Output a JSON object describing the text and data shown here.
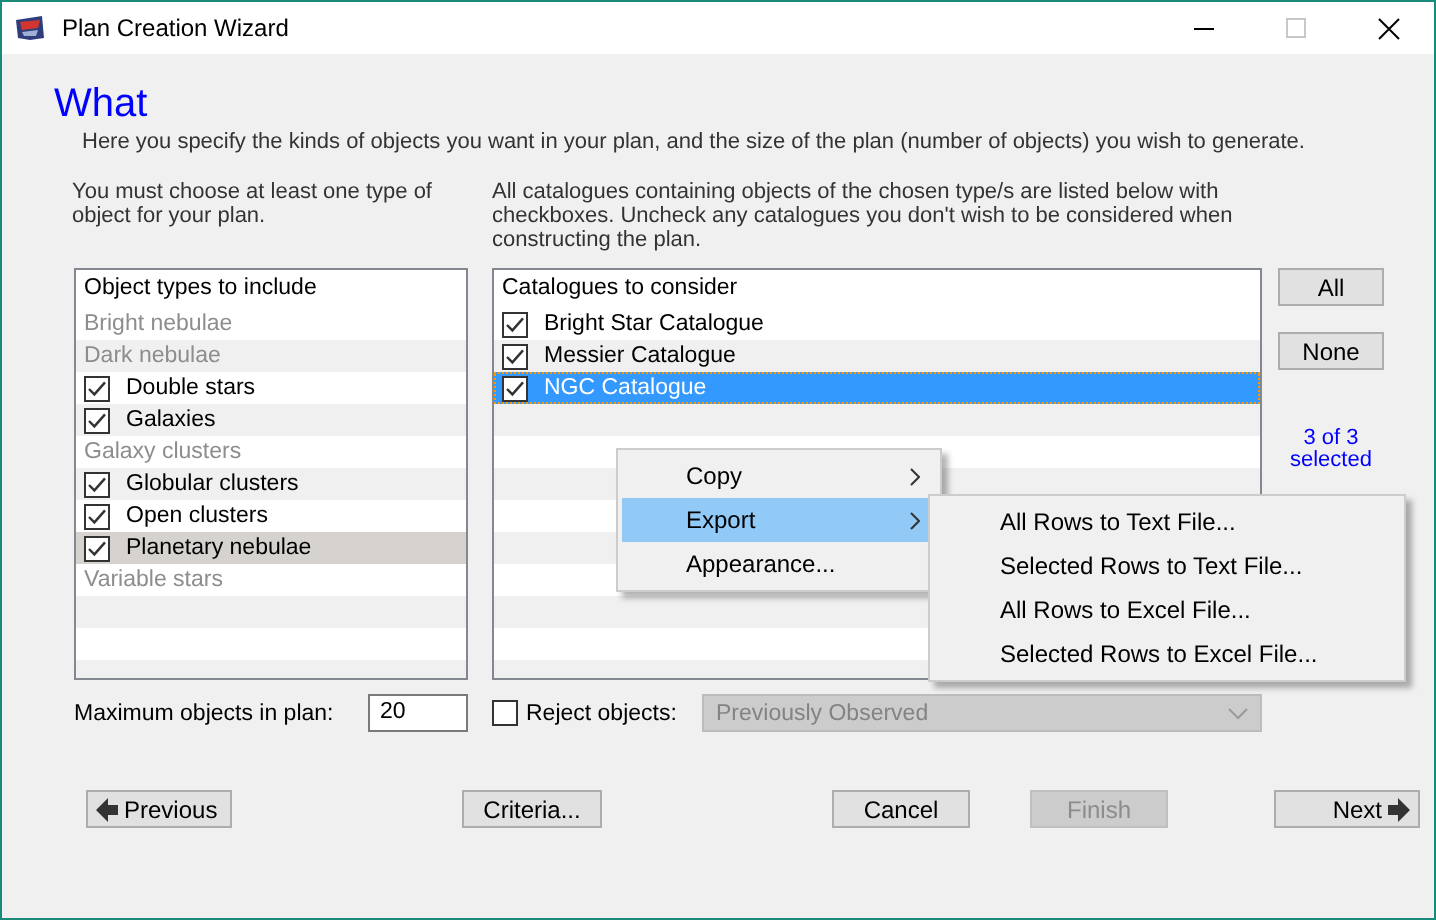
{
  "window": {
    "title": "Plan Creation Wizard"
  },
  "heading": "What",
  "intro": "Here you specify the kinds of objects you want in your plan, and the size of the plan (number of objects) you wish to generate.",
  "left_hint": "You must choose at least one type of object for your plan.",
  "right_hint": "All catalogues containing objects of the chosen type/s are listed below with checkboxes. Uncheck any catalogues you don't wish to be considered when constructing the plan.",
  "object_types": {
    "header": "Object types to include",
    "focused": false,
    "items": [
      {
        "label": "Bright nebulae",
        "disabled": true,
        "selected": false
      },
      {
        "label": "Dark nebulae",
        "disabled": true,
        "selected": false
      },
      {
        "label": "Double stars",
        "disabled": false,
        "checked": true,
        "selected": false
      },
      {
        "label": "Galaxies",
        "disabled": false,
        "checked": true,
        "selected": false
      },
      {
        "label": "Galaxy clusters",
        "disabled": true,
        "selected": false
      },
      {
        "label": "Globular clusters",
        "disabled": false,
        "checked": true,
        "selected": false
      },
      {
        "label": "Open clusters",
        "disabled": false,
        "checked": true,
        "selected": false
      },
      {
        "label": "Planetary nebulae",
        "disabled": false,
        "checked": true,
        "selected": true
      },
      {
        "label": "Variable stars",
        "disabled": true,
        "selected": false
      }
    ]
  },
  "catalogues": {
    "header": "Catalogues to consider",
    "focused": true,
    "items": [
      {
        "label": "Bright Star Catalogue",
        "disabled": false,
        "checked": true,
        "selected": false
      },
      {
        "label": "Messier Catalogue",
        "disabled": false,
        "checked": true,
        "selected": false
      },
      {
        "label": "NGC Catalogue",
        "disabled": false,
        "checked": true,
        "selected": true
      }
    ]
  },
  "side_buttons": [
    "All",
    "None"
  ],
  "selection_count": "3 of 3 selected",
  "max_objects": {
    "label": "Maximum objects in plan:",
    "value": "20"
  },
  "reject": {
    "label": "Reject objects:",
    "checked": false,
    "dropdown": {
      "value": "Previously Observed",
      "disabled": true
    }
  },
  "nav_buttons": [
    {
      "label": "Previous",
      "kind": "back",
      "disabled": false
    },
    {
      "label": "Criteria...",
      "kind": "plain",
      "disabled": false
    },
    {
      "label": "Cancel",
      "kind": "plain",
      "disabled": false
    },
    {
      "label": "Finish",
      "kind": "plain",
      "disabled": true
    },
    {
      "label": "Next",
      "kind": "next",
      "disabled": false
    }
  ],
  "context_menu": {
    "items": [
      {
        "label": "Copy",
        "submenu": true,
        "selected": false
      },
      {
        "label": "Export",
        "submenu": true,
        "selected": true
      },
      {
        "label": "Appearance...",
        "submenu": false,
        "selected": false
      }
    ],
    "submenu": {
      "items": [
        {
          "label": "All Rows to Text File...",
          "selected": false
        },
        {
          "label": "Selected Rows to Text File...",
          "selected": false
        },
        {
          "label": "All Rows to Excel File...",
          "selected": false
        },
        {
          "label": "Selected Rows to Excel File...",
          "selected": false
        }
      ]
    }
  }
}
